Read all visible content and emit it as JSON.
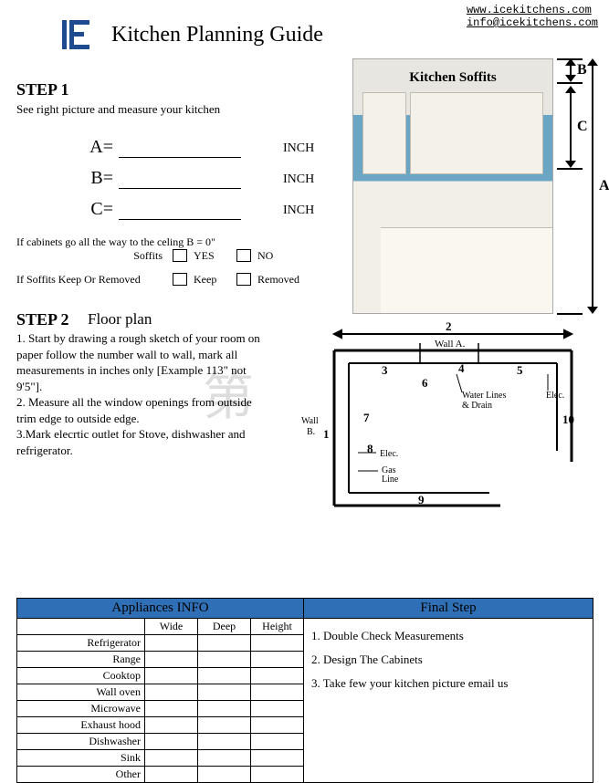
{
  "header": {
    "url": "www.icekitchens.com",
    "email": "info@icekitchens.com"
  },
  "title": "Kitchen Planning Guide",
  "step1": {
    "heading": "STEP 1",
    "instruction": "See right picture and measure your kitchen",
    "rows": [
      {
        "label": "A=",
        "unit": "INCH"
      },
      {
        "label": "B=",
        "unit": "INCH"
      },
      {
        "label": "C=",
        "unit": "INCH"
      }
    ],
    "note": "If  cabinets go all the way to the celing B = 0\"",
    "soffits_label": "Soffits",
    "yes": "YES",
    "no": "NO",
    "keep_label": "If  Soffits Keep Or Removed",
    "keep": "Keep",
    "removed": "Removed"
  },
  "photo": {
    "soffit_label": "Kitchen Soffits",
    "dimA": "A",
    "dimB": "B",
    "dimC": "C"
  },
  "step2": {
    "heading": "STEP 2",
    "subheading": "Floor plan",
    "body": "1. Start by drawing a rough sketch of your room on paper follow the number wall to wall, mark all measurements in inches only [Example 113\"  not 9'5\"].\n2. Measure all the window openings from outside trim edge to outside edge.\n3.Mark elecrtic outlet for Stove, dishwasher and refrigerator."
  },
  "sketch": {
    "wallA": "Wall A.",
    "wallB": "Wall\nB.",
    "water": "Water Lines\n& Drain",
    "elec1": "Elec.",
    "elec2": "Elec.",
    "gas": "Gas\nLine",
    "n1": "1",
    "n2": "2",
    "n3": "3",
    "n4": "4",
    "n5": "5",
    "n6": "6",
    "n7": "7",
    "n8": "8",
    "n9": "9",
    "n10": "10"
  },
  "watermark": "第",
  "table": {
    "left_header": "Appliances INFO",
    "right_header": "Final Step",
    "cols": {
      "wide": "Wide",
      "deep": "Deep",
      "height": "Height"
    },
    "rows": [
      "Refrigerator",
      "Range",
      "Cooktop",
      "Wall oven",
      "Microwave",
      "Exhaust hood",
      "Dishwasher",
      "Sink",
      "Other"
    ],
    "final1": "1. Double Check Measurements",
    "final2": "2. Design The Cabinets",
    "final3": "3. Take few your kitchen picture email us"
  }
}
